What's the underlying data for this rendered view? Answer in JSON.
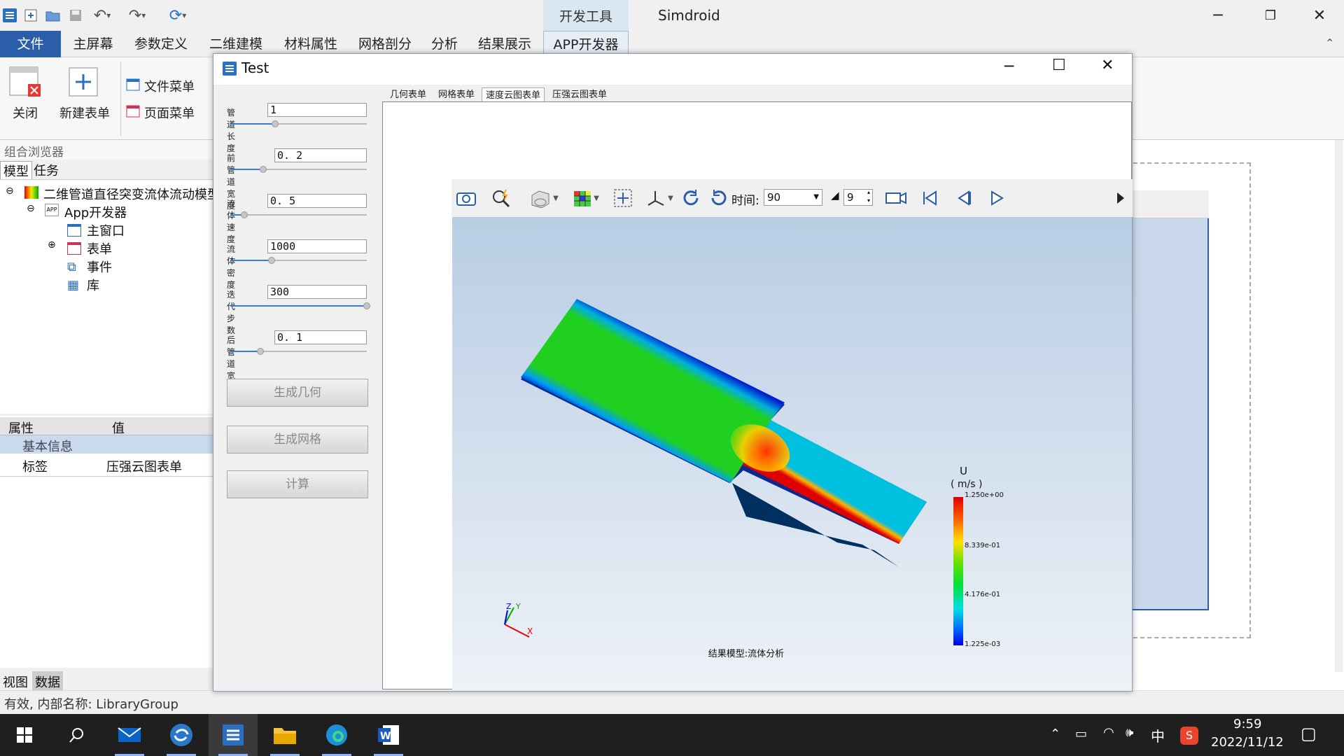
{
  "app": {
    "title": "Simdroid",
    "dev_tools_tab": "开发工具"
  },
  "menus": [
    "文件",
    "主屏幕",
    "参数定义",
    "二维建模",
    "材料属性",
    "网格剖分",
    "分析",
    "结果展示",
    "APP开发器"
  ],
  "ribbon": {
    "close": "关闭",
    "new_form": "新建表单",
    "file_menu": "文件菜单",
    "page_menu": "页面菜单"
  },
  "browser": {
    "header": "组合浏览器",
    "tabs": [
      "模型",
      "任务"
    ],
    "tree": {
      "root": "二维管道直径突变流体流动模型",
      "app_dev": "App开发器",
      "main_window": "主窗口",
      "forms": "表单",
      "events": "事件",
      "library": "库"
    }
  },
  "properties": {
    "col_prop": "属性",
    "col_value": "值",
    "group": "基本信息",
    "label_key": "标签",
    "label_value": "压强云图表单"
  },
  "bottom_tabs": [
    "视图",
    "数据"
  ],
  "status": "有效, 内部名称: LibraryGroup",
  "dialog": {
    "title": "Test",
    "fields": [
      {
        "label": "管道长度",
        "value": "1",
        "slider": 0.33
      },
      {
        "label": "前管道宽度",
        "value": "0. 2",
        "slider": 0.24
      },
      {
        "label": "流体速度",
        "value": "0. 5",
        "slider": 0.1
      },
      {
        "label": "流体密度",
        "value": "1000",
        "slider": 0.3
      },
      {
        "label": "迭代步数",
        "value": "300",
        "slider": 1.0
      },
      {
        "label": "后管道宽度",
        "value": "0. 1",
        "slider": 0.22
      }
    ],
    "buttons": [
      "生成几何",
      "生成网格",
      "计算"
    ],
    "tabs": [
      "几何表单",
      "网格表单",
      "速度云图表单",
      "压强云图表单"
    ],
    "toolbar": {
      "time_label": "时间:",
      "time_value": "90",
      "step_value": "9"
    },
    "legend": {
      "title": "U",
      "unit": "( m/s )",
      "values": [
        "1.250e+00",
        "8.339e-01",
        "4.176e-01",
        "1.225e-03"
      ]
    },
    "footer": "结果模型:流体分析",
    "axes": {
      "x": "X",
      "y": "Y",
      "z": "Z"
    }
  },
  "taskbar": {
    "time": "9:59",
    "date": "2022/11/12",
    "ime": "中"
  },
  "colors": {
    "accent": "#2a5ea8",
    "tree_header": "#c9d9ee",
    "colormap_max": "#e00000",
    "colormap_min": "#0000e0"
  }
}
